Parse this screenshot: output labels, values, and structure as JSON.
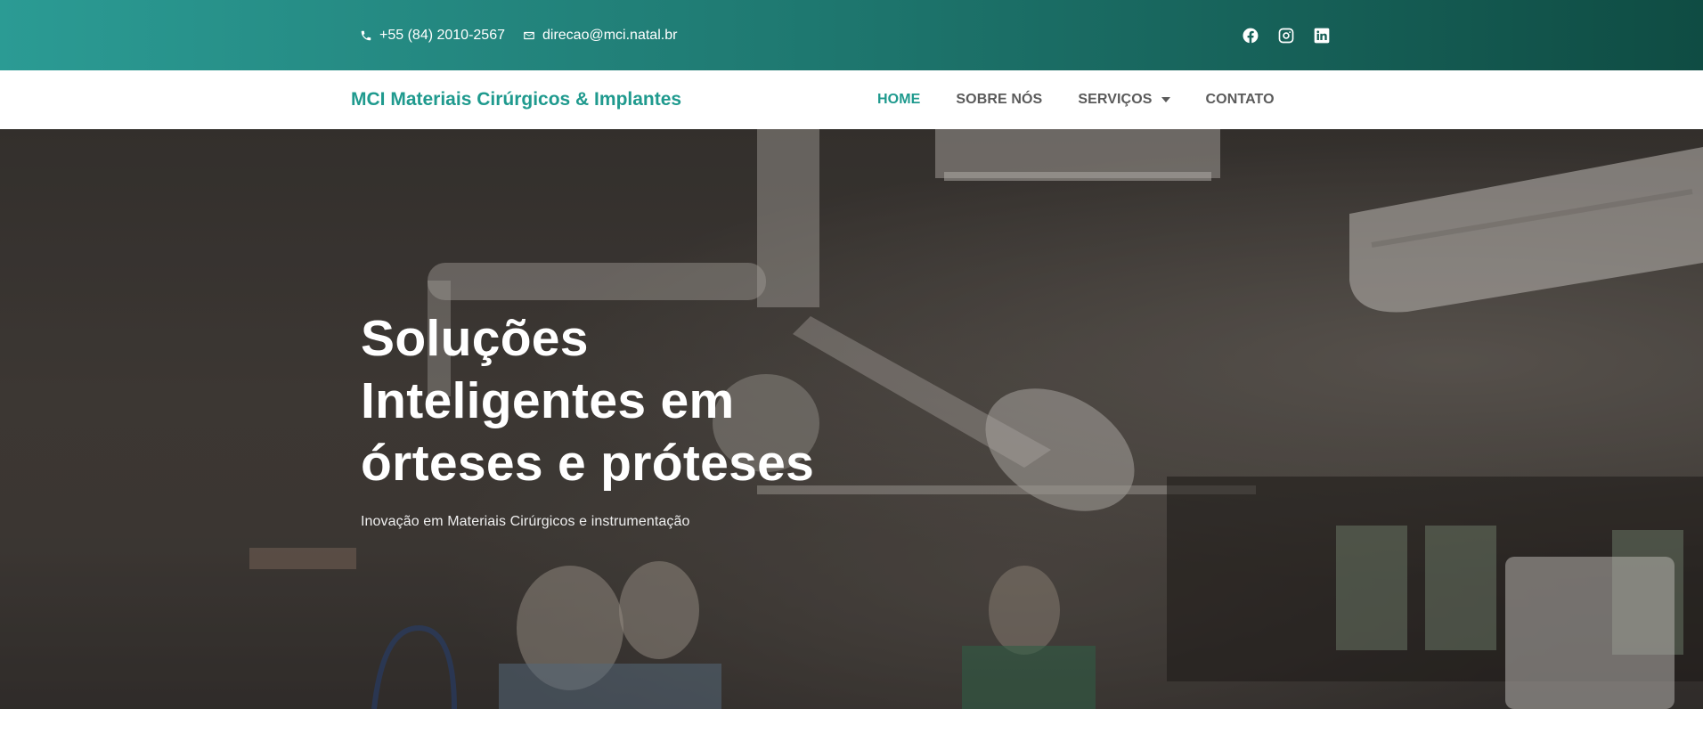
{
  "topbar": {
    "phone": "+55 (84) 2010-2567",
    "email": "direcao@mci.natal.br",
    "phone_icon": "phone-icon",
    "email_icon": "envelope-icon",
    "social": [
      "facebook-icon",
      "instagram-icon",
      "linkedin-icon"
    ]
  },
  "navbar": {
    "brand": "MCI Materiais Cirúrgicos & Implantes",
    "items": [
      {
        "label": "HOME",
        "active": true
      },
      {
        "label": "SOBRE NÓS"
      },
      {
        "label": "SERVIÇOS",
        "has_dropdown": true
      },
      {
        "label": "CONTATO"
      }
    ]
  },
  "hero": {
    "title_lines": [
      "Soluções",
      "Inteligentes em",
      "órteses e próteses"
    ],
    "subtitle": "Inovação em Materiais Cirúrgicos e instrumentação"
  },
  "colors": {
    "accent": "#1f9a8e",
    "topbar_gradient_start": "#2b9b94",
    "topbar_gradient_end": "#0f4c43",
    "nav_text": "#5a5a5a"
  }
}
